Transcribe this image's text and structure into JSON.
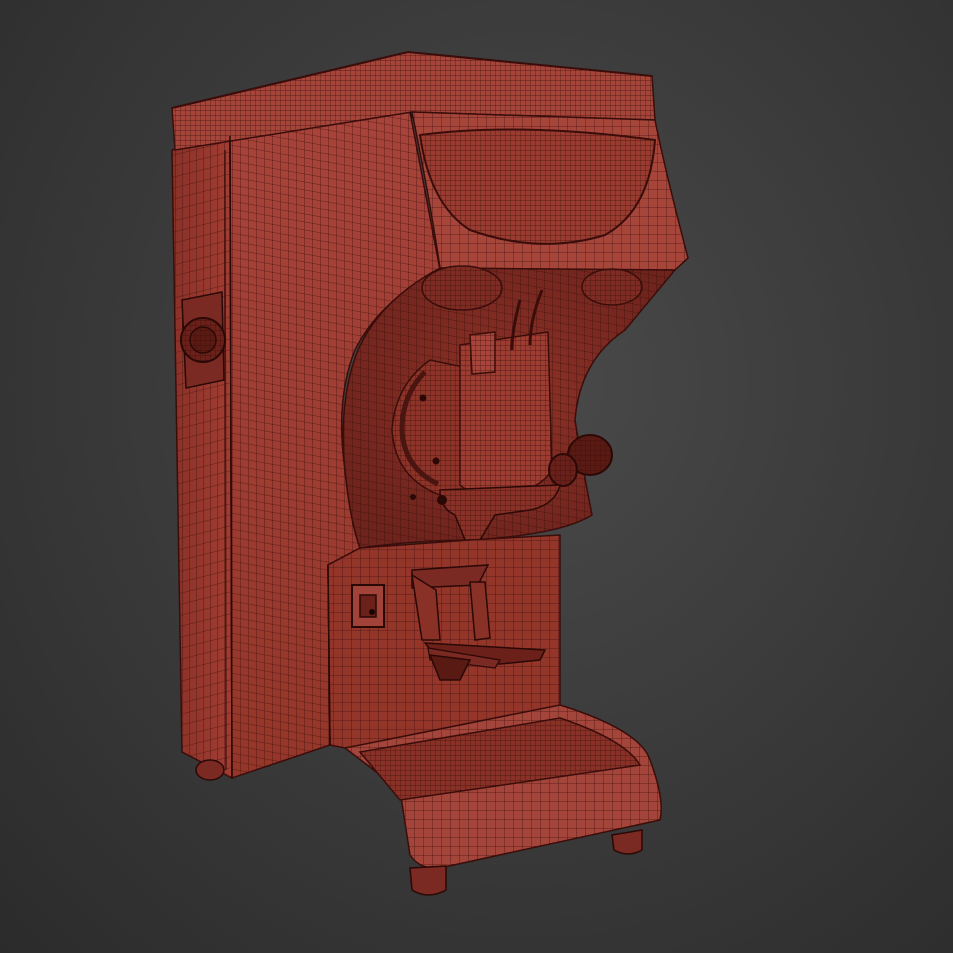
{
  "scene": {
    "object": "coffee-grinder-model",
    "display_mode": "wireframe-on-shaded",
    "colors": {
      "background_center": "#4a4a4a",
      "background_edge": "#2b2b2b",
      "body_fill": "#9e3b30",
      "body_shade": "#7a2a22",
      "body_light": "#b4493c",
      "wire": "#3a0d0a",
      "dark_parts": "#4a1410"
    }
  }
}
